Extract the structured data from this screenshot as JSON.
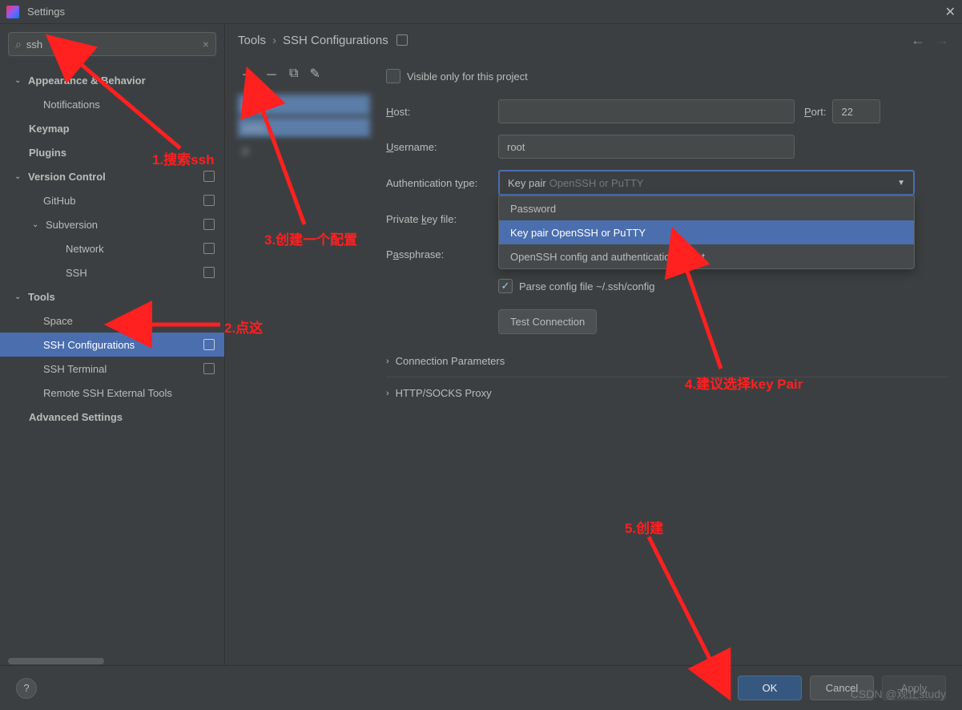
{
  "window": {
    "title": "Settings"
  },
  "search": {
    "value": "ssh"
  },
  "tree": {
    "appearance": {
      "label": "Appearance & Behavior"
    },
    "notifications": {
      "label": "Notifications"
    },
    "keymap": {
      "label": "Keymap"
    },
    "plugins": {
      "label": "Plugins"
    },
    "vcs": {
      "label": "Version Control"
    },
    "github": {
      "label": "GitHub"
    },
    "subversion": {
      "label": "Subversion"
    },
    "network": {
      "label": "Network"
    },
    "ssh": {
      "label": "SSH"
    },
    "tools": {
      "label": "Tools"
    },
    "space": {
      "label": "Space"
    },
    "sshconfig": {
      "label": "SSH Configurations"
    },
    "sshterminal": {
      "label": "SSH Terminal"
    },
    "remotessh": {
      "label": "Remote SSH External Tools"
    },
    "advanced": {
      "label": "Advanced Settings"
    }
  },
  "breadcrumb": {
    "root": "Tools",
    "current": "SSH Configurations"
  },
  "form": {
    "visible_only": "Visible only for this project",
    "host_label": "Host:",
    "host_value": "",
    "port_label": "Port:",
    "port_value": "22",
    "username_label": "Username:",
    "username_value": "root",
    "auth_label": "Authentication type:",
    "auth_selected": "Key pair",
    "auth_hint": "OpenSSH or PuTTY",
    "auth_options": {
      "password": "Password",
      "keypair": "Key pair OpenSSH or PuTTY",
      "agent": "OpenSSH config and authentication agent"
    },
    "private_key_label": "Private key file:",
    "passphrase_label": "Passphrase:",
    "parse_config": "Parse config file ~/.ssh/config",
    "test_connection": "Test Connection",
    "conn_params": "Connection Parameters",
    "proxy": "HTTP/SOCKS Proxy"
  },
  "footer": {
    "ok": "OK",
    "cancel": "Cancel",
    "apply": "Apply"
  },
  "annotations": {
    "a1": "1.搜索ssh",
    "a2": "2.点这",
    "a3": "3.创建一个配置",
    "a4": "4.建议选择key Pair",
    "a5": "5.创建"
  },
  "watermark": "CSDN @观止study"
}
